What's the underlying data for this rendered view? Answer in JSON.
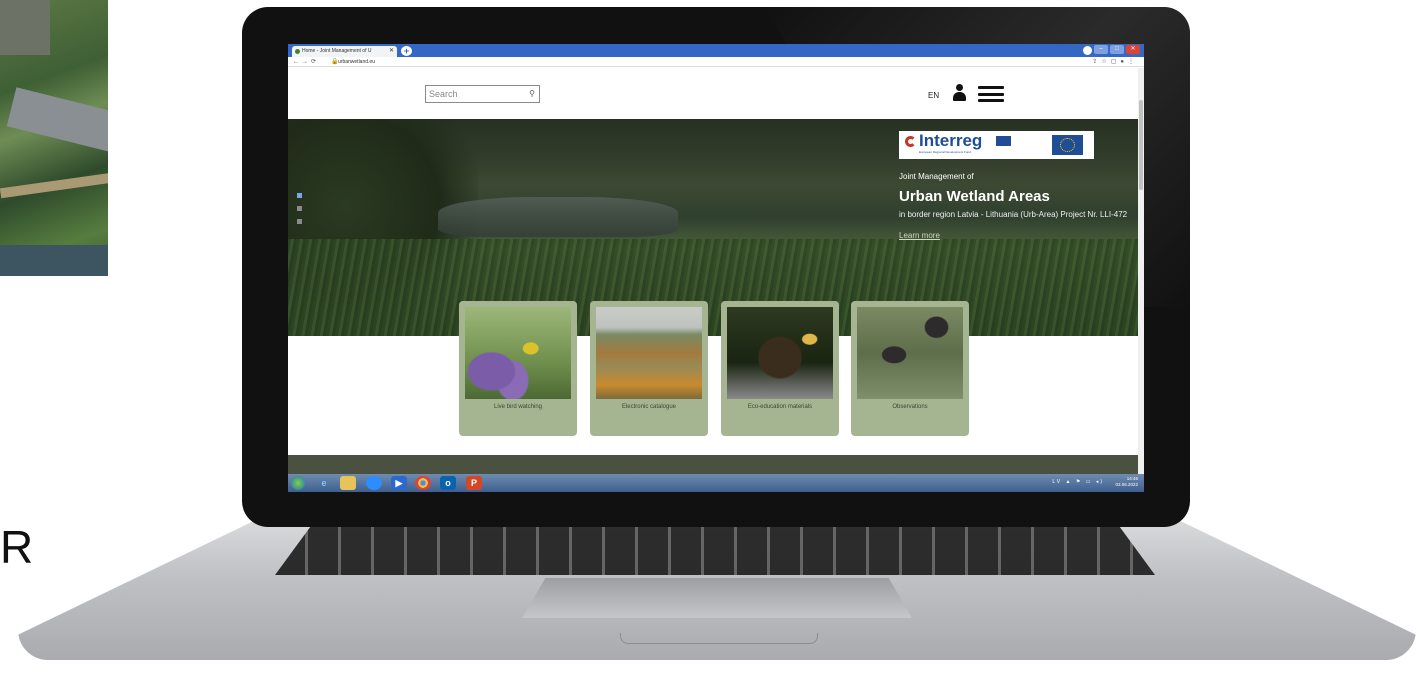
{
  "outside": {
    "stray_letter": "R"
  },
  "browser": {
    "tab_title": "Home - Joint Management of U",
    "url": "urbanwetland.eu",
    "new_tab_label": "+"
  },
  "header": {
    "search_placeholder": "Search",
    "language": "EN"
  },
  "hero": {
    "logo_text": "Interreg",
    "logo_sub": "European Regional Development Fund",
    "kicker": "Joint Management of",
    "title": "Urban Wetland Areas",
    "description": "in border region Latvia - Lithuania (Urb-Area) Project Nr. LLI-472",
    "link": "Learn more",
    "slides_total": 3,
    "slide_active": 1
  },
  "cards": [
    {
      "label": "Live bird watching"
    },
    {
      "label": "Electronic catalogue"
    },
    {
      "label": "Eco-education materials"
    },
    {
      "label": "Observations"
    }
  ],
  "taskbar": {
    "tray_lang": "LV",
    "time": "14:46",
    "date": "03.06.2022"
  },
  "colors": {
    "card_bg": "#a5b592",
    "footer_band": "#4b5140",
    "browser_tabbar": "#3568c5"
  }
}
